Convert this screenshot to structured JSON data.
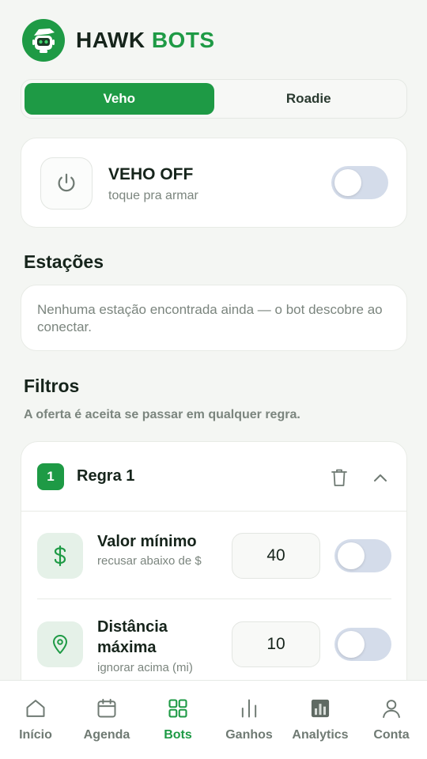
{
  "app": {
    "brand_primary": "HAWK",
    "brand_accent": "BOTS",
    "accent_color": "#1e9a45"
  },
  "platform_tabs": [
    {
      "label": "Veho",
      "active": true
    },
    {
      "label": "Roadie",
      "active": false
    }
  ],
  "power": {
    "icon": "power-icon",
    "title": "VEHO OFF",
    "subtitle": "toque pra armar",
    "enabled": false
  },
  "stations": {
    "title": "Estações",
    "empty_text": "Nenhuma estação encontrada ainda — o bot descobre ao conectar."
  },
  "filters": {
    "title": "Filtros",
    "hint": "A oferta é aceita se passar em qualquer regra.",
    "rule": {
      "number": "1",
      "title": "Regra 1",
      "items": [
        {
          "icon": "dollar-icon",
          "title": "Valor mínimo",
          "subtitle": "recusar abaixo de $",
          "value": "40",
          "enabled": false
        },
        {
          "icon": "location-pin-icon",
          "title": "Distância máxima",
          "subtitle": "ignorar acima (mi)",
          "value": "10",
          "enabled": false
        }
      ]
    }
  },
  "nav": [
    {
      "label": "Início",
      "icon": "home-icon",
      "active": false
    },
    {
      "label": "Agenda",
      "icon": "calendar-icon",
      "active": false
    },
    {
      "label": "Bots",
      "icon": "grid-icon",
      "active": true
    },
    {
      "label": "Ganhos",
      "icon": "bar-chart-icon",
      "active": false
    },
    {
      "label": "Analytics",
      "icon": "analytics-icon",
      "active": false
    },
    {
      "label": "Conta",
      "icon": "user-icon",
      "active": false
    }
  ]
}
